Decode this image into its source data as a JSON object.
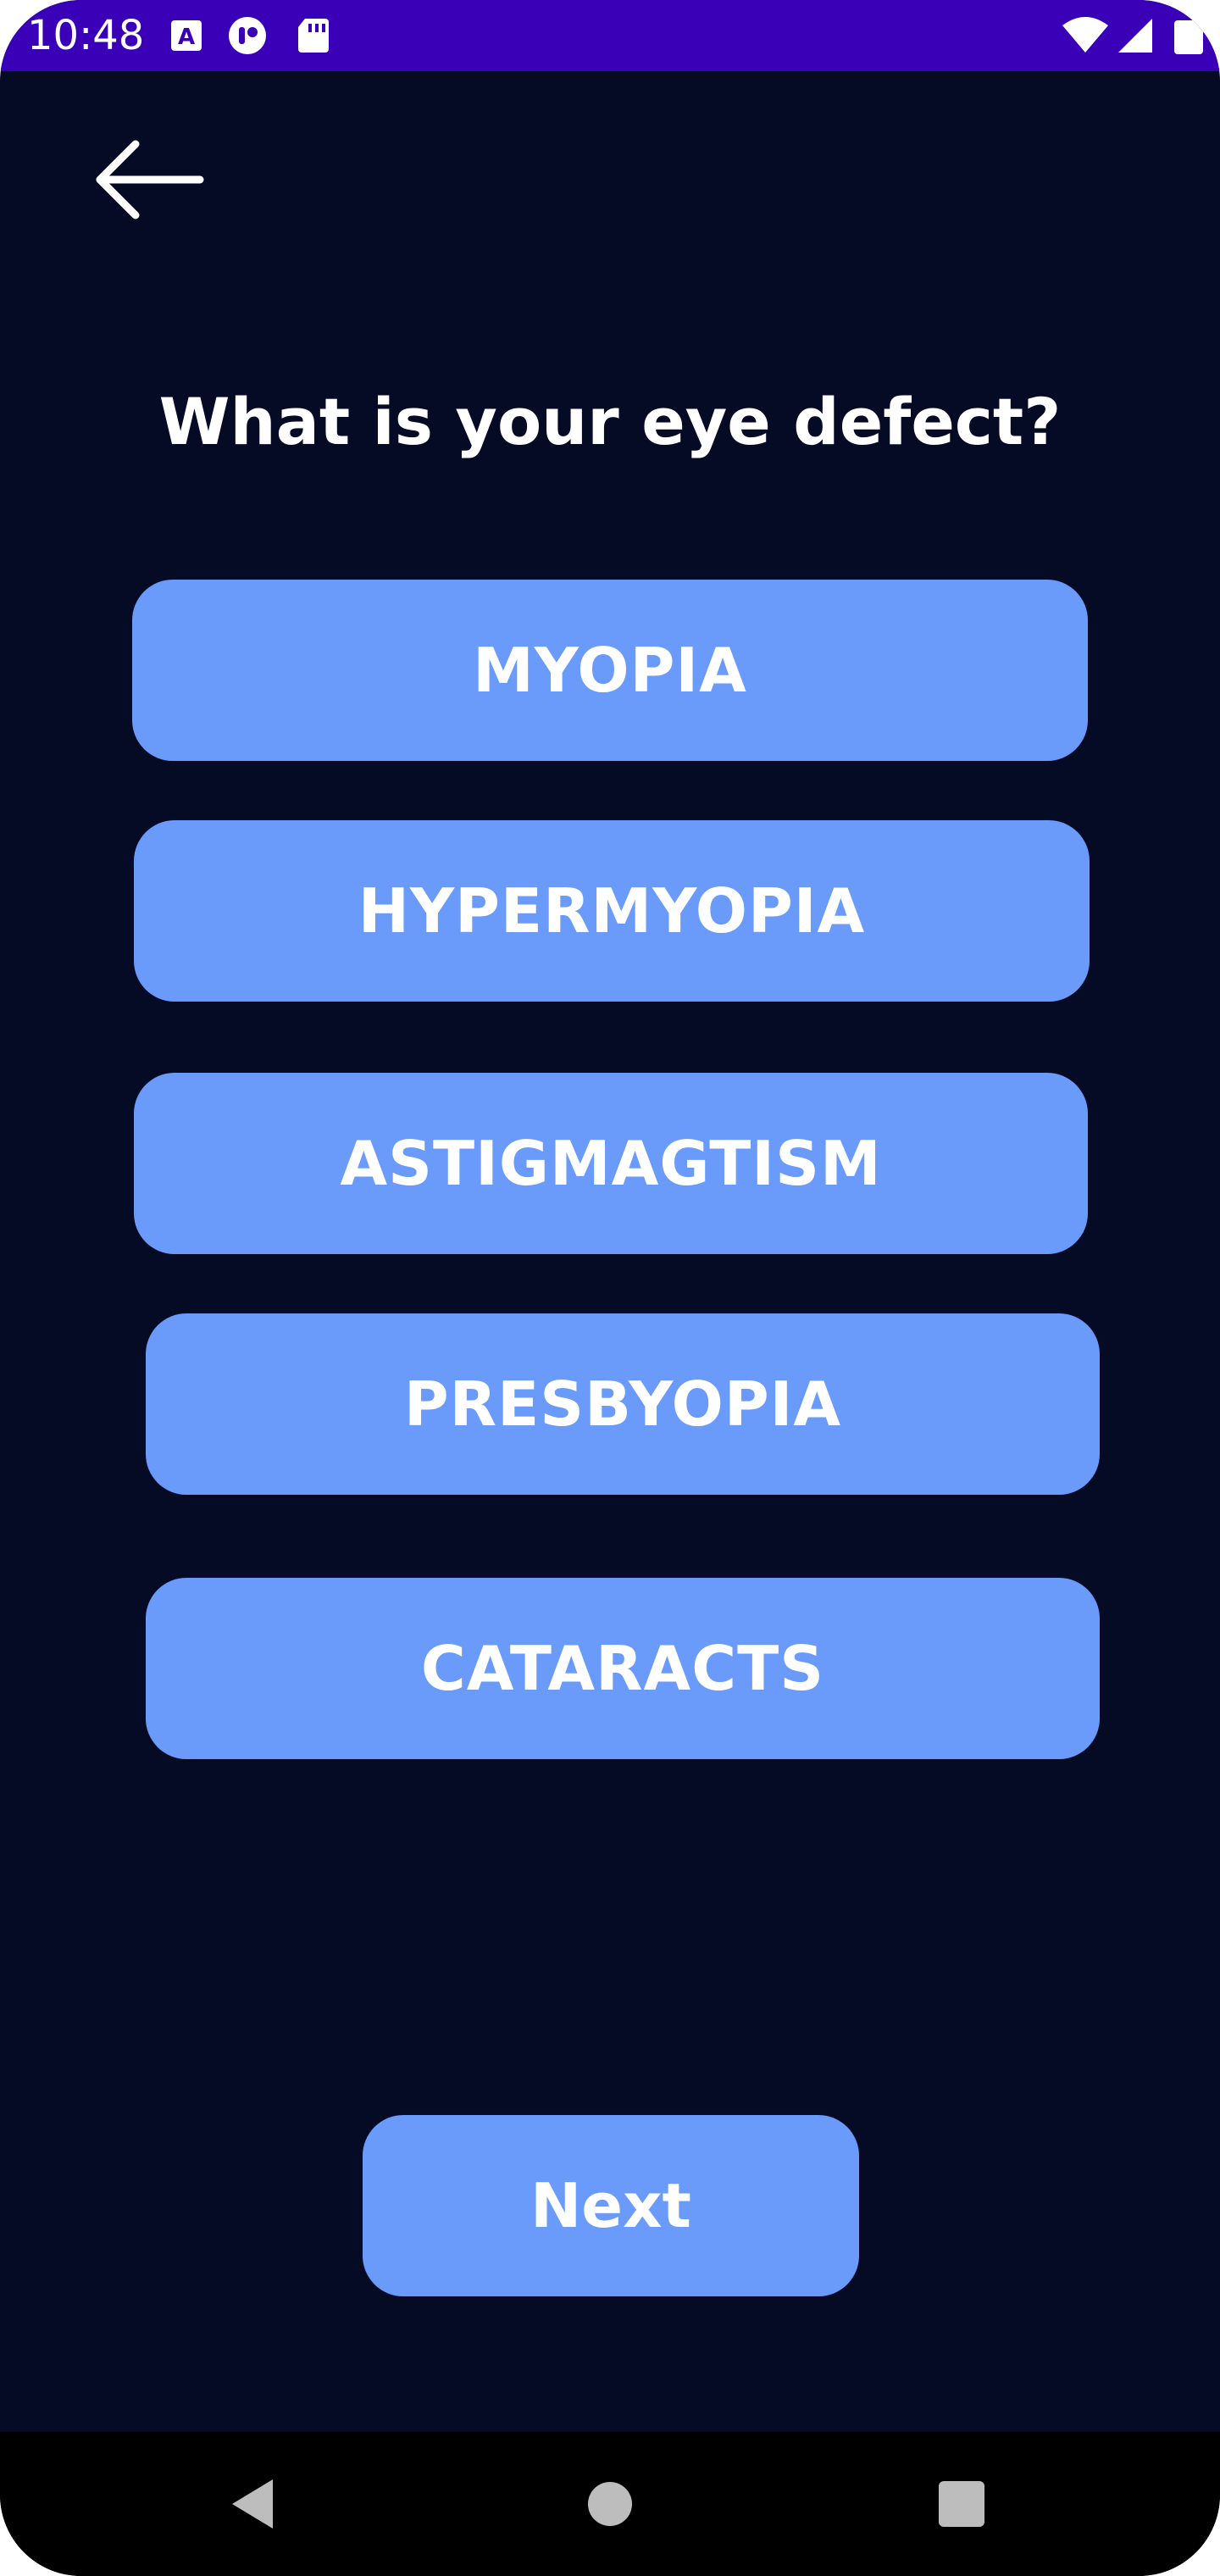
{
  "status_bar": {
    "time": "10:48",
    "icons": [
      "a-notification-icon",
      "podcast-app-icon",
      "sd-card-icon",
      "wifi-icon",
      "cellular-signal-icon",
      "battery-icon"
    ],
    "color": "#3a00b8"
  },
  "header": {
    "back_icon": "back-arrow-icon"
  },
  "question": {
    "text": "What is your eye defect?"
  },
  "options": [
    {
      "label": "MYOPIA"
    },
    {
      "label": "HYPERMYOPIA"
    },
    {
      "label": "ASTIGMAGTISM"
    },
    {
      "label": "PRESBYOPIA"
    },
    {
      "label": "CATARACTS"
    }
  ],
  "next_button": {
    "label": "Next"
  },
  "navigation_bar": {
    "icons": [
      "nav-back-icon",
      "nav-home-icon",
      "nav-recents-icon"
    ]
  },
  "colors": {
    "background": "#050a25",
    "button": "#6a9bfa",
    "text": "#ffffff"
  }
}
